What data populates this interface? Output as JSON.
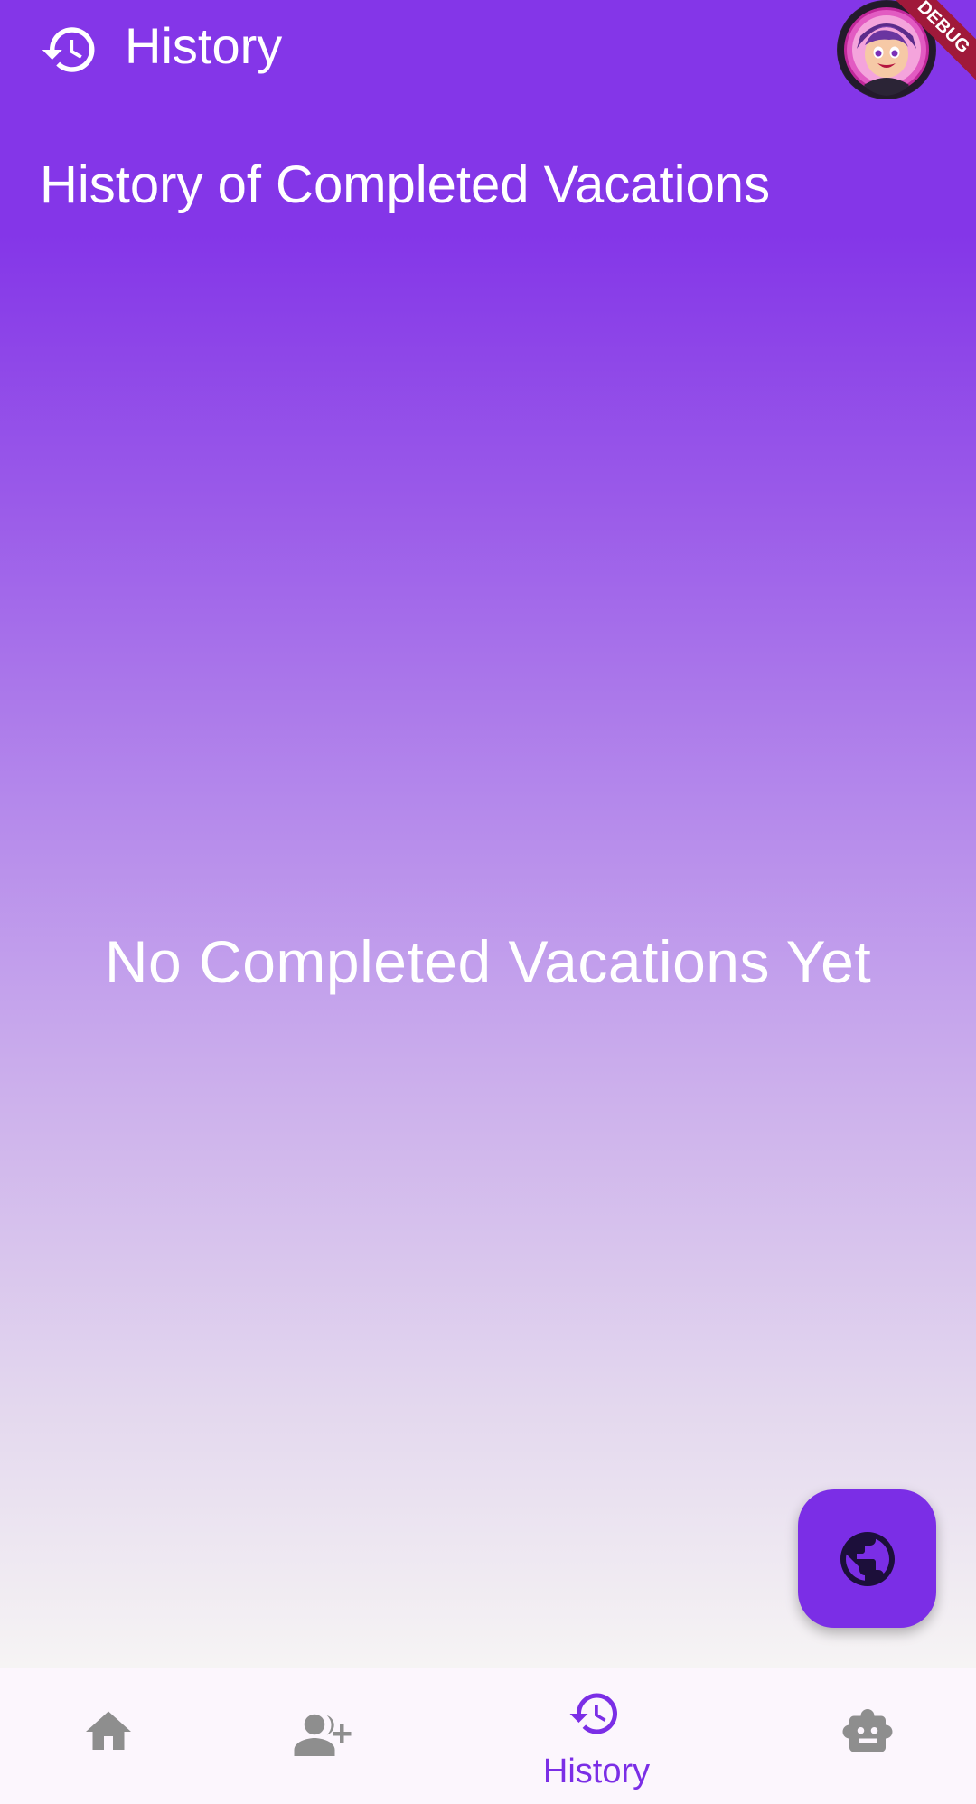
{
  "appbar": {
    "title": "History",
    "icon": "history-icon",
    "avatar": "avatar",
    "debug_banner": "DEBUG"
  },
  "main": {
    "heading": "History of Completed Vacations",
    "empty_message": "No Completed Vacations Yet"
  },
  "fab": {
    "icon": "globe-icon"
  },
  "bottom_nav": {
    "items": [
      {
        "icon": "home-icon",
        "label": "",
        "selected": false
      },
      {
        "icon": "add-person-icon",
        "label": "",
        "selected": false
      },
      {
        "icon": "history-icon",
        "label": "History",
        "selected": true
      },
      {
        "icon": "robot-icon",
        "label": "",
        "selected": false
      }
    ]
  },
  "colors": {
    "primary": "#7b2ee6",
    "gradient_top": "#8436e8",
    "gradient_bottom": "#f6f4f4",
    "nav_inactive": "#8e8e8e",
    "nav_background": "#fcf6fd",
    "banner": "#a0193a"
  }
}
